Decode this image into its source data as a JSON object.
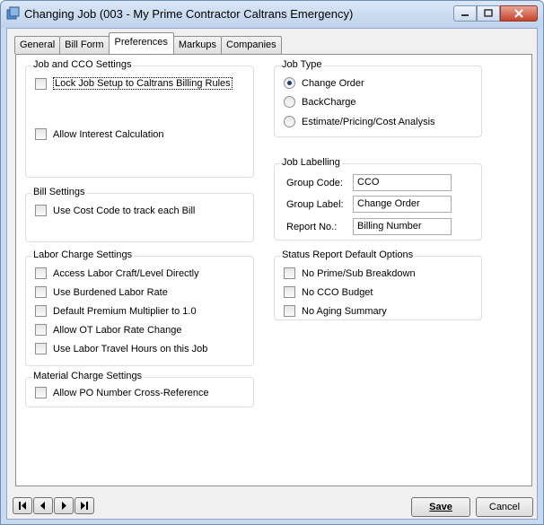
{
  "window": {
    "title": "Changing Job  (003 - My Prime Contractor Caltrans Emergency)",
    "icon": "job-window-icon"
  },
  "tabs": [
    {
      "label": "General"
    },
    {
      "label": "Bill Form"
    },
    {
      "label": "Preferences",
      "active": true
    },
    {
      "label": "Markups"
    },
    {
      "label": "Companies"
    }
  ],
  "job_cco": {
    "title": "Job and CCO Settings",
    "lock": {
      "label": "Lock Job Setup to Caltrans Billing Rules",
      "checked": false
    },
    "interest": {
      "label": "Allow Interest Calculation",
      "checked": false
    }
  },
  "bill_settings": {
    "title": "Bill Settings",
    "cost_code": {
      "label": "Use Cost Code to track each Bill",
      "checked": false
    }
  },
  "labor": {
    "title": "Labor Charge Settings",
    "items": [
      {
        "label": "Access Labor Craft/Level Directly",
        "checked": false
      },
      {
        "label": "Use Burdened Labor Rate",
        "checked": false
      },
      {
        "label": "Default Premium Multiplier to 1.0",
        "checked": false
      },
      {
        "label": "Allow OT Labor Rate Change",
        "checked": false
      },
      {
        "label": "Use Labor Travel Hours on this Job",
        "checked": false
      }
    ]
  },
  "material": {
    "title": "Material Charge Settings",
    "po_xref": {
      "label": "Allow PO Number Cross-Reference",
      "checked": false
    }
  },
  "job_type": {
    "title": "Job Type",
    "options": [
      {
        "label": "Change Order",
        "selected": true
      },
      {
        "label": "BackCharge",
        "selected": false
      },
      {
        "label": "Estimate/Pricing/Cost Analysis",
        "selected": false
      }
    ]
  },
  "labelling": {
    "title": "Job Labelling",
    "group_code": {
      "label": "Group Code:",
      "value": "CCO"
    },
    "group_label": {
      "label": "Group Label:",
      "value": "Change Order"
    },
    "report_no": {
      "label": "Report No.:",
      "value": "Billing Number"
    }
  },
  "status_report": {
    "title": "Status Report Default Options",
    "items": [
      {
        "label": "No Prime/Sub Breakdown",
        "checked": false
      },
      {
        "label": "No CCO Budget",
        "checked": false
      },
      {
        "label": "No Aging Summary",
        "checked": false
      }
    ]
  },
  "footer": {
    "save_label": "Save",
    "cancel_label": "Cancel"
  }
}
